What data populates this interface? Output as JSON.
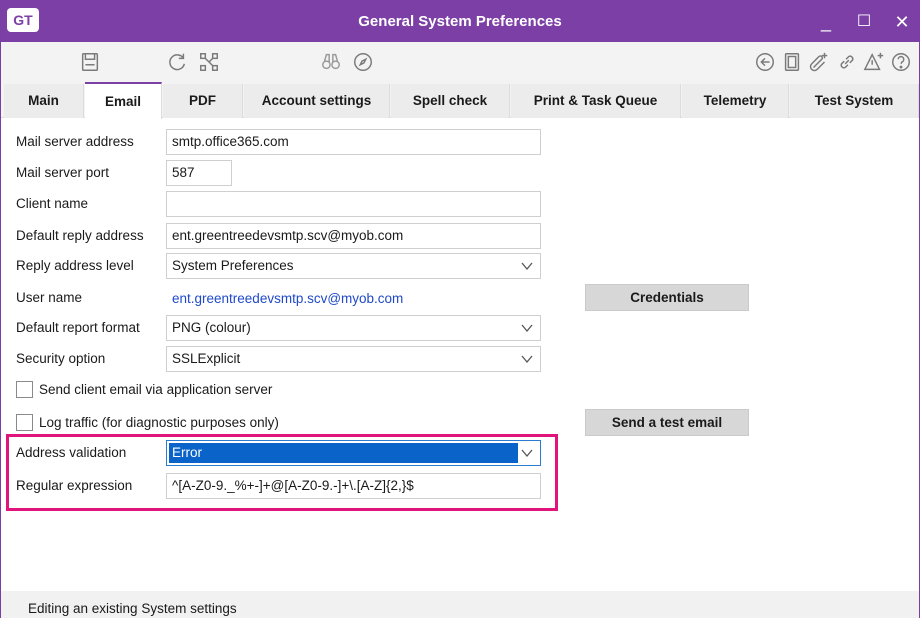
{
  "window": {
    "logo": "GT",
    "title": "General System Preferences",
    "minimize": "_",
    "maximize": "☐",
    "close": "✕"
  },
  "toolbar": {
    "left_icons": [
      "save-icon",
      "refresh-icon",
      "network-icon",
      "binoculars-icon",
      "compass-icon"
    ],
    "right_icons": [
      "back-circle-icon",
      "document-icon",
      "attach-add-icon",
      "link-icon",
      "alert-add-icon",
      "help-icon"
    ]
  },
  "tabs": [
    {
      "label": "Main"
    },
    {
      "label": "Email",
      "active": true
    },
    {
      "label": "PDF"
    },
    {
      "label": "Account settings"
    },
    {
      "label": "Spell check"
    },
    {
      "label": "Print & Task Queue"
    },
    {
      "label": "Telemetry"
    },
    {
      "label": "Test System"
    }
  ],
  "form": {
    "mail_server_address": {
      "label": "Mail server address",
      "value": "smtp.office365.com"
    },
    "mail_server_port": {
      "label": "Mail server port",
      "value": "587"
    },
    "client_name": {
      "label": "Client name",
      "value": ""
    },
    "default_reply_address": {
      "label": "Default reply address",
      "value": "ent.greentreedevsmtp.scv@myob.com"
    },
    "reply_address_level": {
      "label": "Reply address level",
      "value": "System Preferences"
    },
    "user_name": {
      "label": "User name",
      "value": "ent.greentreedevsmtp.scv@myob.com"
    },
    "default_report_format": {
      "label": "Default report format",
      "value": "PNG (colour)"
    },
    "security_option": {
      "label": "Security option",
      "value": "SSLExplicit"
    },
    "send_via_app_server": {
      "label": "Send client email via application server",
      "checked": false
    },
    "log_traffic": {
      "label": "Log traffic (for diagnostic purposes only)",
      "checked": false
    },
    "address_validation": {
      "label": "Address validation",
      "value": "Error"
    },
    "regular_expression": {
      "label": "Regular expression",
      "value": "^[A-Z0-9._%+-]+@[A-Z0-9.-]+\\.[A-Z]{2,}$"
    }
  },
  "buttons": {
    "credentials": "Credentials",
    "send_test_email": "Send a test email"
  },
  "status": {
    "text": "Editing an existing System settings"
  },
  "colors": {
    "title_bar": "#7b3fa6",
    "highlight": "#e0147a",
    "selection": "#0a63c9",
    "link": "#1f49c9"
  }
}
